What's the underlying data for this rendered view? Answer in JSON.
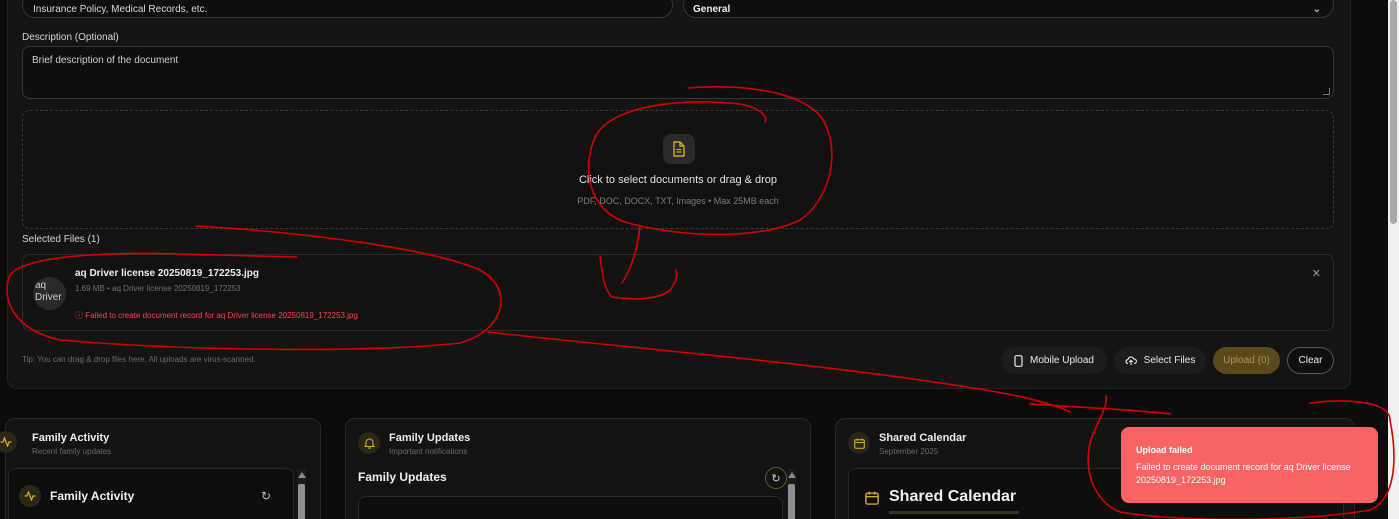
{
  "form": {
    "title_value": "Insurance Policy, Medical Records, etc.",
    "category_value": "General",
    "description_label": "Description (Optional)",
    "description_value": "Brief description of the document"
  },
  "dropzone": {
    "title": "Click to select documents or drag & drop",
    "subtitle": "PDF, DOC, DOCX, TXT, Images  •  Max 25MB each",
    "icon": "document-icon"
  },
  "selected_files": {
    "label": "Selected Files (1)",
    "files": [
      {
        "thumb_alt": "aq Driver",
        "name": "aq Driver license 20250819_172253.jpg",
        "meta": "1.69 MB  • aq Driver license 20250819_172253",
        "error": "Failed to create document record for aq Driver license 20250819_172253.jpg"
      }
    ]
  },
  "footer": {
    "tip": "Tip: You can drag & drop files here. All uploads are virus-scanned.",
    "mobile_upload": "Mobile Upload",
    "select_files": "Select Files",
    "upload": "Upload (0)",
    "clear": "Clear"
  },
  "panels": {
    "activity": {
      "title": "Family Activity",
      "subtitle": "Recent family updates",
      "inner_title": "Family Activity"
    },
    "updates": {
      "title": "Family Updates",
      "subtitle": "Important notifications",
      "inner_title": "Family Updates"
    },
    "calendar": {
      "title": "Shared Calendar",
      "subtitle": "September 2025",
      "inner_title": "Shared Calendar"
    }
  },
  "toast": {
    "title": "Upload failed",
    "message": "Failed to create document record for aq Driver license 20250819_172253.jpg"
  },
  "colors": {
    "accent": "#d4a92a",
    "error": "#ef4a4a",
    "toast_bg": "#f86464",
    "annotation": "#d40000"
  }
}
